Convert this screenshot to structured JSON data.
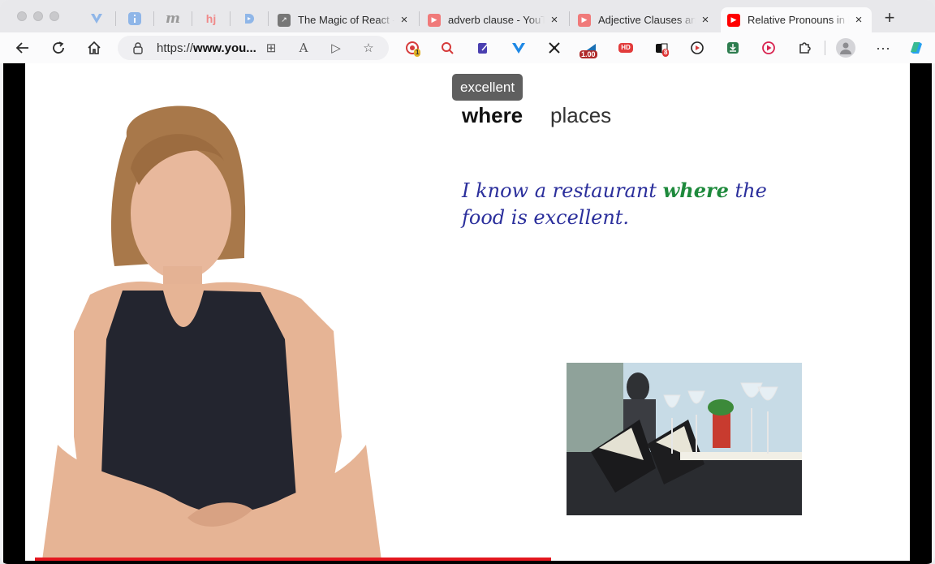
{
  "tabs": {
    "pinned": [
      {
        "icon": "vue-v-icon",
        "glyph": "V",
        "color": "#8fb6e8"
      },
      {
        "icon": "info-icon",
        "glyph": "i",
        "color": "#8fb6e8"
      },
      {
        "icon": "m-logo-icon",
        "glyph": "m",
        "color": "#9a9a9a"
      },
      {
        "icon": "hj-logo-icon",
        "glyph": "hj",
        "color": "#f08a8a"
      },
      {
        "icon": "d-logo-icon",
        "glyph": "D",
        "color": "#8fb6e8"
      }
    ],
    "items": [
      {
        "title": "The Magic of React -",
        "active": false
      },
      {
        "title": "adverb clause - YouTu",
        "active": false
      },
      {
        "title": "Adjective Clauses and",
        "active": false
      },
      {
        "title": "Relative Pronouns in E",
        "active": true
      }
    ]
  },
  "toolbar": {
    "url_prefix": "https://",
    "url_domain": "www.you...",
    "extension_badges": {
      "rec": "1",
      "speed": "1.00",
      "hd": "HD",
      "count": "8"
    }
  },
  "video": {
    "tooltip": "excellent",
    "keyword": "where",
    "keyword_meaning": "places",
    "sentence_before": "I know a restaurant ",
    "sentence_highlight": "where",
    "sentence_after": " the food is excellent.",
    "progress_percent": 59,
    "colors": {
      "sentence": "#2b2f9c",
      "highlight": "#1e8a3c",
      "progress": "#e4171f"
    }
  }
}
